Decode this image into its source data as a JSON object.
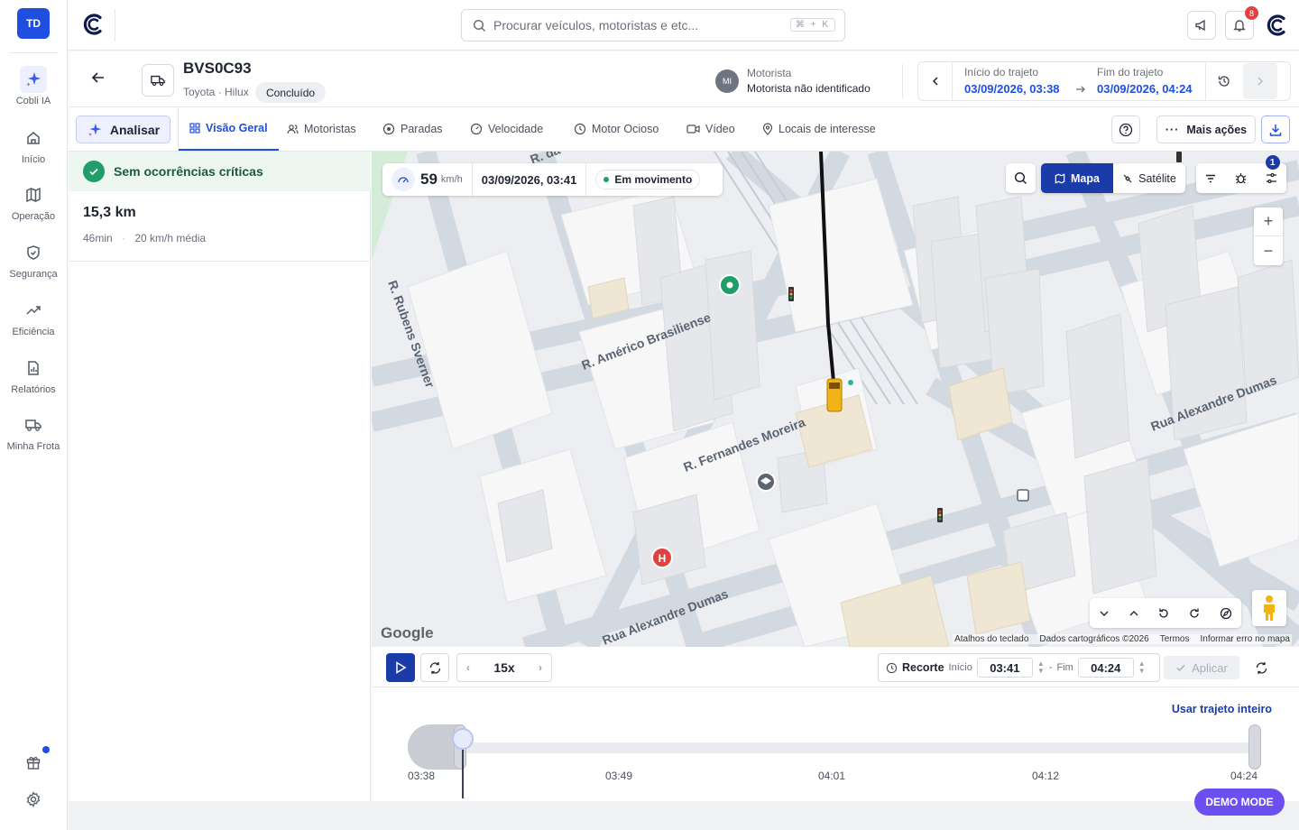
{
  "user": {
    "initials": "TD"
  },
  "rail": {
    "items": [
      {
        "label": "Cobli IA"
      },
      {
        "label": "Início"
      },
      {
        "label": "Operação"
      },
      {
        "label": "Segurança"
      },
      {
        "label": "Eficiência"
      },
      {
        "label": "Relatórios"
      },
      {
        "label": "Minha Frota"
      }
    ]
  },
  "topbar": {
    "search_placeholder": "Procurar veículos, motoristas e etc...",
    "shortcut": "⌘ + K",
    "notifications_count": "8"
  },
  "vehicle": {
    "plate": "BVS0C93",
    "model": "Toyota · Hilux",
    "status": "Concluído",
    "driver_label": "Motorista",
    "driver_initials": "MI",
    "driver_value": "Motorista não identificado"
  },
  "trip": {
    "start_label": "Início do trajeto",
    "start_value": "03/09/2026, 03:38",
    "end_label": "Fim do trajeto",
    "end_value": "03/09/2026, 04:24"
  },
  "tabs": {
    "analisar": "Analisar",
    "items": [
      {
        "label": "Visão Geral"
      },
      {
        "label": "Motoristas"
      },
      {
        "label": "Paradas"
      },
      {
        "label": "Velocidade"
      },
      {
        "label": "Motor Ocioso"
      },
      {
        "label": "Vídeo"
      },
      {
        "label": "Locais de interesse"
      }
    ],
    "more_actions": "Mais ações"
  },
  "summary": {
    "critical": "Sem ocorrências críticas",
    "distance": "15,3 km",
    "duration": "46min",
    "avg_speed": "20 km/h média"
  },
  "map": {
    "speed": "59",
    "speed_unit": "km/h",
    "timestamp": "03/09/2026, 03:41",
    "moving": "Em movimento",
    "view_map": "Mapa",
    "view_satellite": "Satélite",
    "filter_count": "1",
    "google": "Google",
    "attribution": [
      "Atalhos do teclado",
      "Dados cartográficos ©2026",
      "Termos",
      "Informar erro no mapa"
    ],
    "streets": [
      "R. Américo Brasiliense",
      "R. Fernandes Moreira",
      "Rua Alexandre Dumas",
      "Rua Alexandre Dumas",
      "R. Rubens Sverner",
      "R. da Pa..."
    ]
  },
  "playback": {
    "speed": "15x",
    "recorte": "Recorte",
    "inicio_label": "Início",
    "inicio_value": "03:41",
    "fim_label": "Fim",
    "fim_value": "04:24",
    "aplicar": "Aplicar",
    "usar": "Usar trajeto inteiro",
    "ticks": [
      "03:38",
      "03:49",
      "04:01",
      "04:12",
      "04:24"
    ],
    "progress": 0.065
  },
  "demo_mode": "DEMO MODE",
  "colors": {
    "accent": "#1f4fe0",
    "primary_dark": "#1a3ba8",
    "success": "#1f9e6a",
    "demo": "#6c4ff0"
  }
}
